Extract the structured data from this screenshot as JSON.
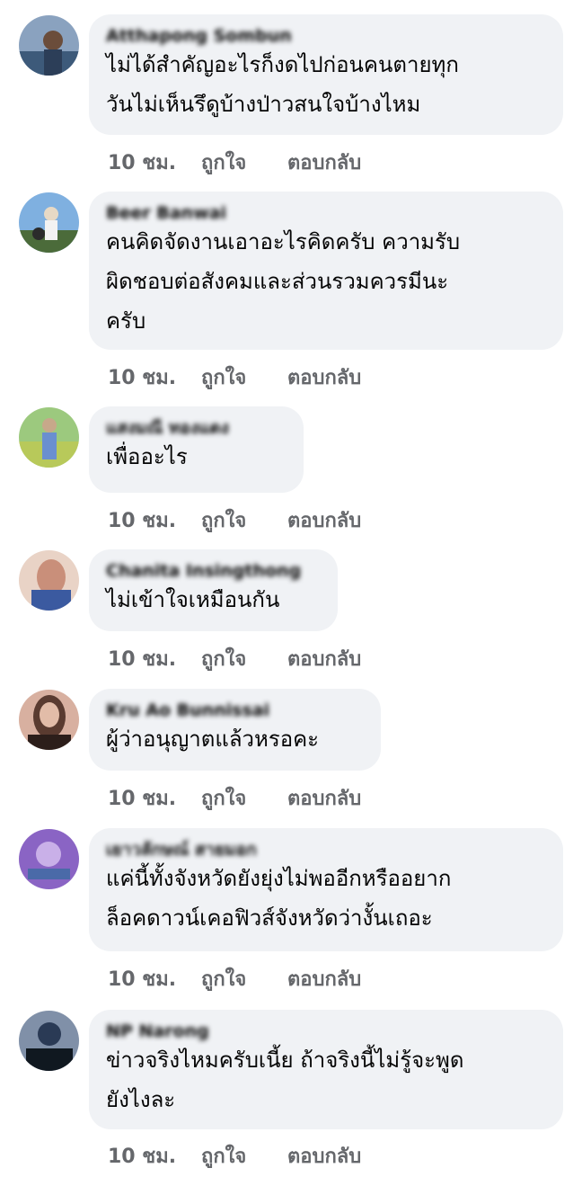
{
  "comments": [
    {
      "author": "Atthapong Sombun",
      "text": [
        "ไม่ได้สำคัญอะไรก็งดไปก่อนคนตายทุก",
        "วันไม่เห็นรึดูบ้างป่าวสนใจบ้างไหม"
      ],
      "avatar_colors": [
        "#3d5a7a",
        "#8aa2bf",
        "#6b4d3b"
      ]
    },
    {
      "author": "Beer Banwai",
      "text": [
        "คนคิดจัดงานเอาอะไรคิดครับ ความรับ",
        "ผิดชอบต่อสังคมและส่วนรวมควรมีนะ",
        "ครับ"
      ],
      "avatar_colors": [
        "#7fb0e0",
        "#4b6b3a",
        "#e7d9c5"
      ]
    },
    {
      "author": "แสงมณี ทองแดง",
      "text": [
        "เพื่ออะไร"
      ],
      "avatar_colors": [
        "#8fbf7a",
        "#b8c95a",
        "#6a8fd0"
      ]
    },
    {
      "author": "Chanita Insingthong",
      "text": [
        "ไม่เข้าใจเหมือนกัน"
      ],
      "avatar_colors": [
        "#c98f7a",
        "#3b5aa0",
        "#e8c2b0"
      ]
    },
    {
      "author": "Kru Ao Bunnissai",
      "text": [
        "ผู้ว่าอนุญาตแล้วหรอคะ"
      ],
      "avatar_colors": [
        "#5a3b30",
        "#d8b0a0",
        "#2c1e1a"
      ]
    },
    {
      "author": "เยาวลักษณ์ สายมอก",
      "text": [
        "แค่นี้ทั้งจังหวัดยังยุ่งไม่พออีกหรืออยาก",
        "ล็อคดาวน์เคอฟิวส์จังหวัดว่างั้นเถอะ"
      ],
      "avatar_colors": [
        "#8a64c4",
        "#c9b0e8",
        "#4a6aa8"
      ]
    },
    {
      "author": "NP Narong",
      "text": [
        "ข่าวจริงไหมครับเนี้ย ถ้าจริงนี้ไม่รู้จะพูด",
        "ยังไงละ"
      ],
      "avatar_colors": [
        "#2a3a55",
        "#8090a8",
        "#101820"
      ]
    }
  ],
  "actions": {
    "time": "10 ชม.",
    "like": "ถูกใจ",
    "reply": "ตอบกลับ"
  }
}
